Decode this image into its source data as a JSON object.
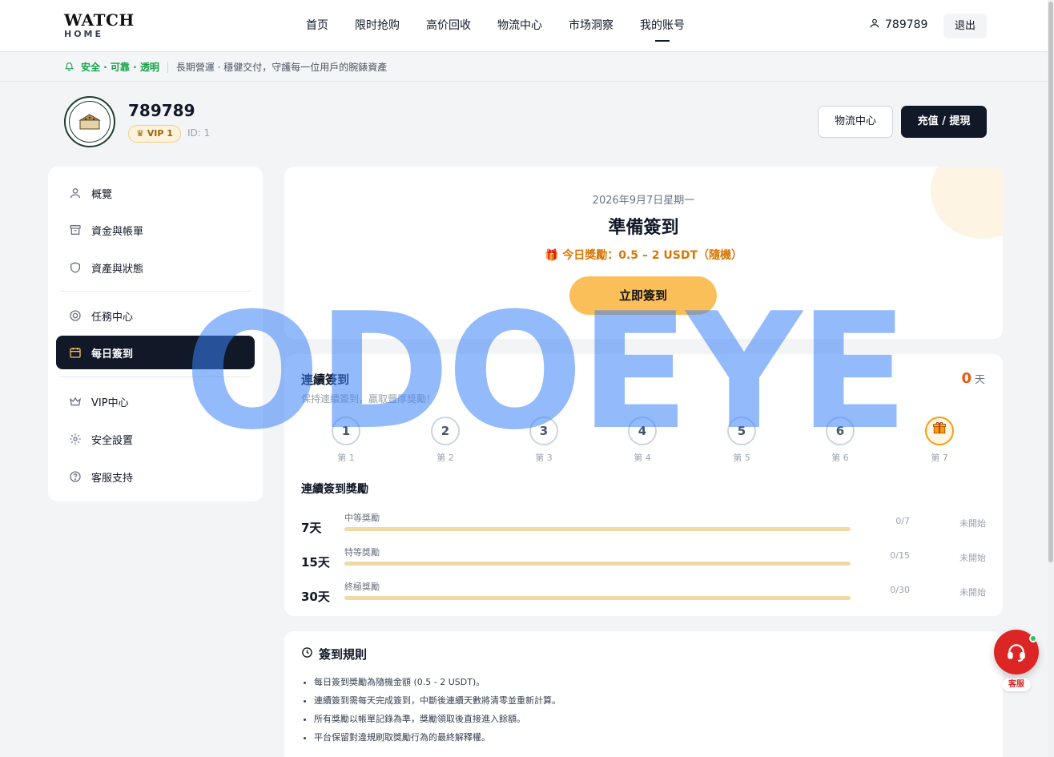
{
  "header": {
    "logo_main": "WATCH",
    "logo_sub": "HOME",
    "nav": [
      "首页",
      "限时抢购",
      "高价回收",
      "物流中心",
      "市场洞察",
      "我的账号"
    ],
    "user": "789789",
    "logout": "退出"
  },
  "notice": {
    "safe": "安全 · 可靠 · 透明",
    "text": "長期營運 · 穩健交付，守護每一位用戶的腕錶資產"
  },
  "profile": {
    "name": "789789",
    "vip": "VIP 1",
    "id": "ID: 1",
    "btn_logistics": "物流中心",
    "btn_recharge": "充值 / 提現"
  },
  "sidebar": {
    "items": [
      {
        "label": "概覽",
        "icon": "user-icon"
      },
      {
        "label": "資金與帳單",
        "icon": "archive-icon"
      },
      {
        "label": "資產與狀態",
        "icon": "shield-icon"
      },
      {
        "label": "任務中心",
        "icon": "target-icon"
      },
      {
        "label": "每日簽到",
        "icon": "calendar-icon"
      },
      {
        "label": "VIP中心",
        "icon": "crown-icon"
      },
      {
        "label": "安全設置",
        "icon": "gear-icon"
      },
      {
        "label": "客服支持",
        "icon": "help-icon"
      }
    ]
  },
  "checkin": {
    "date": "2026年9月7日星期一",
    "title": "準備簽到",
    "reward": "今日獎勵：0.5 – 2 USDT（隨機）",
    "button": "立即簽到"
  },
  "streak": {
    "title": "連續簽到",
    "subtitle": "保持連續簽到，贏取豐厚獎勵！",
    "count": "0",
    "unit": "天",
    "days": [
      {
        "num": "1",
        "label": "第 1"
      },
      {
        "num": "2",
        "label": "第 2"
      },
      {
        "num": "3",
        "label": "第 3"
      },
      {
        "num": "4",
        "label": "第 4"
      },
      {
        "num": "5",
        "label": "第 5"
      },
      {
        "num": "6",
        "label": "第 6"
      },
      {
        "num": "",
        "label": "第 7"
      }
    ],
    "rewards_title": "連續簽到獎勵",
    "rewards": [
      {
        "days": "7天",
        "name": "中等獎勵",
        "progress": "0/7",
        "status": "未開始"
      },
      {
        "days": "15天",
        "name": "特等獎勵",
        "progress": "0/15",
        "status": "未開始"
      },
      {
        "days": "30天",
        "name": "終極獎勵",
        "progress": "0/30",
        "status": "未開始"
      }
    ]
  },
  "rules": {
    "title": "簽到規則",
    "items": [
      "每日簽到獎勵為隨機金額 (0.5 - 2 USDT)。",
      "連續簽到需每天完成簽到，中斷後連續天數將清零並重新計算。",
      "所有獎勵以帳單記錄為準，獎勵領取後直接進入餘額。",
      "平台保留對違規刷取獎勵行為的最終解釋權。"
    ]
  },
  "service": {
    "label": "客服"
  },
  "watermark": "ODOEYE",
  "colors": {
    "accent": "#fbbf5a",
    "dark": "#111827",
    "reward": "#d97706",
    "service": "#dc2626"
  }
}
